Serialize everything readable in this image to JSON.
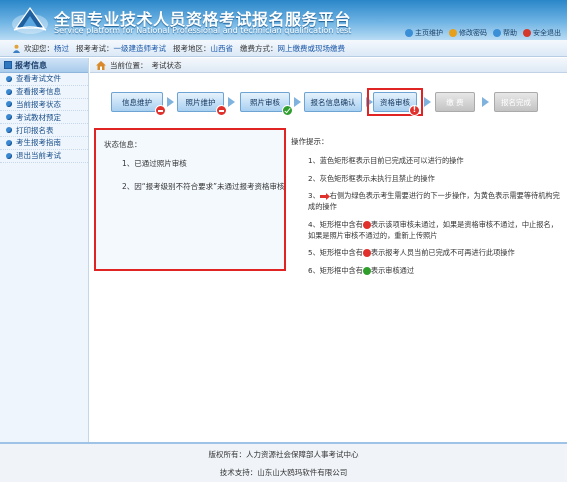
{
  "header": {
    "title_cn": "全国专业技术人员资格考试报名服务平台",
    "title_en": "Service platform for National Professional and technician qualification test",
    "links": [
      {
        "label": "主页维护",
        "icon": "home-icon",
        "color": "#3a8fd6"
      },
      {
        "label": "修改密码",
        "icon": "key-icon",
        "color": "#e6a01c"
      },
      {
        "label": "帮助",
        "icon": "help-icon",
        "color": "#3a8fd6"
      },
      {
        "label": "安全退出",
        "icon": "logout-icon",
        "color": "#d33a2c"
      }
    ]
  },
  "infobar": {
    "welcome_label": "欢迎您：",
    "welcome_value": "杨过",
    "exam_label": "报考考试：",
    "exam_value": "一级建造师考试",
    "region_label": "报考地区：",
    "region_value": "山西省",
    "pay_label": "缴费方式：",
    "pay_value": "网上缴费或现场缴费"
  },
  "sidebar": {
    "header": "报考信息",
    "items": [
      {
        "label": "查看考试文件"
      },
      {
        "label": "查看报考信息"
      },
      {
        "label": "当前报考状态"
      },
      {
        "label": "考试教材预定"
      },
      {
        "label": "打印报名表"
      },
      {
        "label": "考生报考指南"
      },
      {
        "label": "退出当前考试"
      }
    ]
  },
  "breadcrumb": {
    "prefix": "当前位置：",
    "current": "考试状态"
  },
  "steps": [
    {
      "label": "信息维护",
      "state": "active",
      "badge": "red"
    },
    {
      "label": "照片维护",
      "state": "active",
      "badge": "red"
    },
    {
      "label": "照片审核",
      "state": "active",
      "badge": "green"
    },
    {
      "label": "报名信息确认",
      "state": "active",
      "badge": "none"
    },
    {
      "label": "资格审核",
      "state": "active",
      "badge": "excl"
    },
    {
      "label": "缴 费",
      "state": "disabled",
      "badge": "none"
    },
    {
      "label": "报名完成",
      "state": "disabled",
      "badge": "none"
    }
  ],
  "status": {
    "title": "状态信息：",
    "lines": [
      "1、已通过照片审核",
      "2、因“报考级别不符合要求”未通过报考资格审核"
    ]
  },
  "tips": {
    "title": "操作提示：",
    "line1": "1、蓝色矩形框表示目前已完成还可以进行的操作",
    "line2": "2、灰色矩形框表示未执行且禁止的操作",
    "line3_prefix": "3、",
    "line3_text": "右侧为绿色表示考生需要进行的下一步操作，为黄色表示需要等待机构完成的操作",
    "line4_prefix": "4、矩形框中含有",
    "line4_text": "表示该项审核未通过，如果是资格审核不通过，中止报名，如果是照片审核不通过的，重新上传照片",
    "line5_prefix": "5、矩形框中含有",
    "line5_text": "表示报考人员当前已完成不可再进行此项操作",
    "line6_prefix": "6、矩形框中含有",
    "line6_text": "表示审核通过"
  },
  "footer": {
    "copyright": "版权所有：人力资源社会保障部人事考试中心",
    "support": "技术支持：山东山大鸥玛软件有限公司"
  },
  "colors": {
    "highlight": "#e02424",
    "step_blue_border": "#6ea4d4",
    "step_grey_border": "#aaaaaa"
  }
}
